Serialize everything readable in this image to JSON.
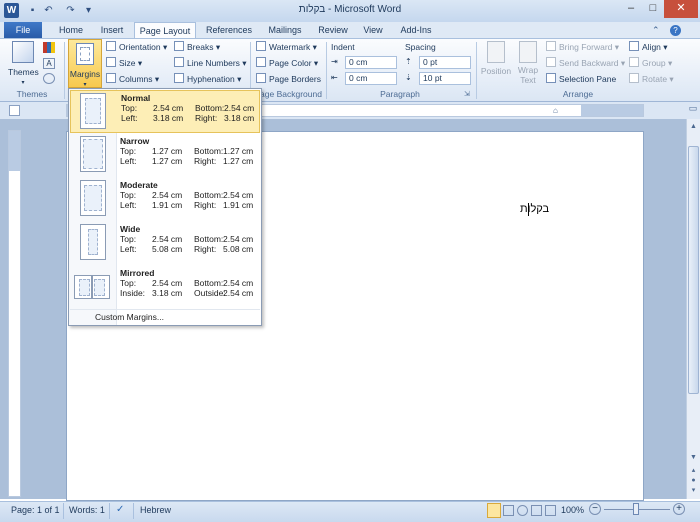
{
  "window": {
    "title": "בקלות - Microsoft Word",
    "min": "–",
    "max": "□",
    "close": "✕"
  },
  "qat": {
    "icons": [
      "save-icon",
      "undo-icon",
      "redo-icon",
      "customize-icon"
    ],
    "glyphs": [
      "▪",
      "↶",
      "↷",
      "▾"
    ]
  },
  "tabs": [
    "File",
    "Home",
    "Insert",
    "Page Layout",
    "References",
    "Mailings",
    "Review",
    "View",
    "Add-Ins"
  ],
  "ribbon": {
    "themes": {
      "label": "Themes",
      "group": "Themes"
    },
    "margins": {
      "label": "Margins"
    },
    "page_setup": {
      "orientation": "Orientation",
      "size": "Size",
      "columns": "Columns",
      "breaks": "Breaks",
      "line_numbers": "Line Numbers",
      "hyphenation": "Hyphenation"
    },
    "page_background": {
      "watermark": "Watermark",
      "page_color": "Page Color",
      "page_borders": "Page Borders",
      "group": "age Background"
    },
    "paragraph": {
      "indent_label": "Indent",
      "spacing_label": "Spacing",
      "indent_left": "0 cm",
      "indent_right": "0 cm",
      "spacing_before": "0 pt",
      "spacing_after": "10 pt",
      "group": "Paragraph"
    },
    "arrange": {
      "position": "Position",
      "wrap_text_1": "Wrap",
      "wrap_text_2": "Text",
      "bring_forward": "Bring Forward",
      "send_backward": "Send Backward",
      "selection_pane": "Selection Pane",
      "align": "Align",
      "group_btn": "Group",
      "rotate": "Rotate",
      "group": "Arrange"
    }
  },
  "margins_menu": {
    "options": [
      {
        "name": "Normal",
        "r1": [
          "Top:",
          "2.54 cm",
          "Bottom:",
          "2.54 cm"
        ],
        "r2": [
          "Left:",
          "3.18 cm",
          "Right:",
          "3.18 cm"
        ]
      },
      {
        "name": "Narrow",
        "r1": [
          "Top:",
          "1.27 cm",
          "Bottom:",
          "1.27 cm"
        ],
        "r2": [
          "Left:",
          "1.27 cm",
          "Right:",
          "1.27 cm"
        ]
      },
      {
        "name": "Moderate",
        "r1": [
          "Top:",
          "2.54 cm",
          "Bottom:",
          "2.54 cm"
        ],
        "r2": [
          "Left:",
          "1.91 cm",
          "Right:",
          "1.91 cm"
        ]
      },
      {
        "name": "Wide",
        "r1": [
          "Top:",
          "2.54 cm",
          "Bottom:",
          "2.54 cm"
        ],
        "r2": [
          "Left:",
          "5.08 cm",
          "Right:",
          "5.08 cm"
        ]
      },
      {
        "name": "Mirrored",
        "r1": [
          "Top:",
          "2.54 cm",
          "Bottom:",
          "2.54 cm"
        ],
        "r2": [
          "Inside:",
          "3.18 cm",
          "Outside:",
          "2.54 cm"
        ]
      }
    ],
    "custom": "Custom Margins..."
  },
  "document": {
    "text": "בקלות"
  },
  "status": {
    "page": "Page: 1 of 1",
    "words": "Words: 1",
    "language": "Hebrew",
    "zoom": "100%",
    "zoom_out": "−",
    "zoom_in": "+"
  }
}
